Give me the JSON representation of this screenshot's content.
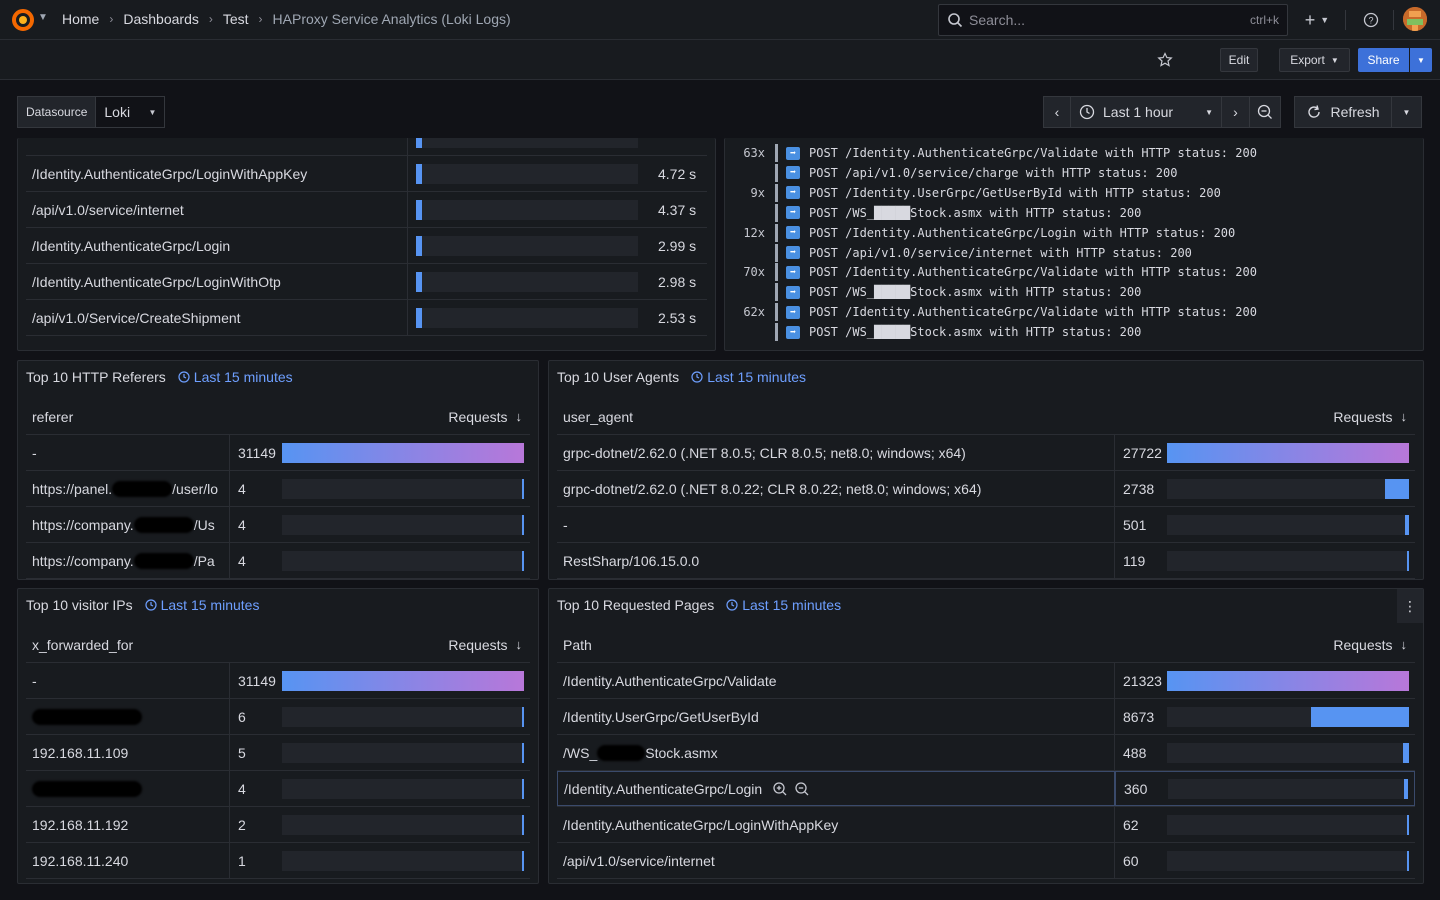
{
  "breadcrumb": [
    "Home",
    "Dashboards",
    "Test"
  ],
  "page_title": "HAProxy Service Analytics (Loki Logs)",
  "search": {
    "placeholder": "Search...",
    "shortcut": "ctrl+k"
  },
  "toolbar": {
    "edit": "Edit",
    "export": "Export",
    "share": "Share"
  },
  "variables": {
    "label": "Datasource",
    "value": "Loki"
  },
  "time": {
    "range": "Last 1 hour",
    "refresh": "Refresh"
  },
  "slow_endpoints": [
    {
      "path": "/Identity.AuthenticateGrpc/LoginWithAppKey",
      "value": "4.72 s"
    },
    {
      "path": "/api/v1.0/service/internet",
      "value": "4.37 s"
    },
    {
      "path": "/Identity.AuthenticateGrpc/Login",
      "value": "2.99 s"
    },
    {
      "path": "/Identity.AuthenticateGrpc/LoginWithOtp",
      "value": "2.98 s"
    },
    {
      "path": "/api/v1.0/Service/CreateShipment",
      "value": "2.53 s"
    }
  ],
  "logs": [
    {
      "count": "63x",
      "text": "POST /Identity.AuthenticateGrpc/Validate with HTTP status: 200"
    },
    {
      "count": "",
      "text": "POST /api/v1.0/service/charge with HTTP status: 200"
    },
    {
      "count": "9x",
      "text": "POST /Identity.UserGrpc/GetUserById with HTTP status: 200"
    },
    {
      "count": "",
      "text": "POST /WS_█████Stock.asmx with HTTP status: 200"
    },
    {
      "count": "12x",
      "text": "POST /Identity.AuthenticateGrpc/Login with HTTP status: 200"
    },
    {
      "count": "",
      "text": "POST /api/v1.0/service/internet with HTTP status: 200"
    },
    {
      "count": "70x",
      "text": "POST /Identity.AuthenticateGrpc/Validate with HTTP status: 200"
    },
    {
      "count": "",
      "text": "POST /WS_█████Stock.asmx with HTTP status: 200"
    },
    {
      "count": "62x",
      "text": "POST /Identity.AuthenticateGrpc/Validate with HTTP status: 200"
    },
    {
      "count": "",
      "text": "POST /WS_█████Stock.asmx with HTTP status: 200"
    }
  ],
  "referers": {
    "title": "Top 10 HTTP Referers",
    "time_tag": "Last 15 minutes",
    "col1": "referer",
    "col2": "Requests",
    "rows": [
      {
        "name": "-",
        "value": "31149",
        "fraction": 1.0
      },
      {
        "name": "https://panel.",
        "suffix": "/user/lo",
        "value": "4",
        "fraction": 0.0001
      },
      {
        "name": "https://company.",
        "suffix": "/Us",
        "value": "4",
        "fraction": 0.0001
      },
      {
        "name": "https://company.",
        "suffix": "/Pa",
        "value": "4",
        "fraction": 0.0001
      }
    ]
  },
  "user_agents": {
    "title": "Top 10 User Agents",
    "time_tag": "Last 15 minutes",
    "col1": "user_agent",
    "col2": "Requests",
    "rows": [
      {
        "name": "grpc-dotnet/2.62.0 (.NET 8.0.5; CLR 8.0.5; net8.0; windows; x64)",
        "value": "27722",
        "fraction": 1.0
      },
      {
        "name": "grpc-dotnet/2.62.0 (.NET 8.0.22; CLR 8.0.22; net8.0; windows; x64)",
        "value": "2738",
        "fraction": 0.099
      },
      {
        "name": "-",
        "value": "501",
        "fraction": 0.018
      },
      {
        "name": "RestSharp/106.15.0.0",
        "value": "119",
        "fraction": 0.004
      }
    ]
  },
  "visitor_ips": {
    "title": "Top 10 visitor IPs",
    "time_tag": "Last 15 minutes",
    "col1": "x_forwarded_for",
    "col2": "Requests",
    "rows": [
      {
        "name": "-",
        "value": "31149",
        "fraction": 1.0
      },
      {
        "name": "",
        "masked": true,
        "value": "6",
        "fraction": 0.0002
      },
      {
        "name": "192.168.11.109",
        "value": "5",
        "fraction": 0.00016
      },
      {
        "name": "",
        "masked": true,
        "value": "4",
        "fraction": 0.00013
      },
      {
        "name": "192.168.11.192",
        "value": "2",
        "fraction": 6e-05
      },
      {
        "name": "192.168.11.240",
        "value": "1",
        "fraction": 3e-05
      }
    ]
  },
  "pages": {
    "title": "Top 10 Requested Pages",
    "time_tag": "Last 15 minutes",
    "col1": "Path",
    "col2": "Requests",
    "rows": [
      {
        "name": "/Identity.AuthenticateGrpc/Validate",
        "value": "21323",
        "fraction": 1.0
      },
      {
        "name": "/Identity.UserGrpc/GetUserById",
        "value": "8673",
        "fraction": 0.407
      },
      {
        "name": "/WS_",
        "suffix": "Stock.asmx",
        "masked_mid": true,
        "value": "488",
        "fraction": 0.023
      },
      {
        "name": "/Identity.AuthenticateGrpc/Login",
        "value": "360",
        "fraction": 0.017,
        "hover": true
      },
      {
        "name": "/Identity.AuthenticateGrpc/LoginWithAppKey",
        "value": "62",
        "fraction": 0.003
      },
      {
        "name": "/api/v1.0/service/internet",
        "value": "60",
        "fraction": 0.003
      }
    ]
  },
  "colors": {
    "accent": "#3d71d9",
    "link": "#6e9fff",
    "bar_start": "#5794f2",
    "bar_end": "#b877d9"
  }
}
